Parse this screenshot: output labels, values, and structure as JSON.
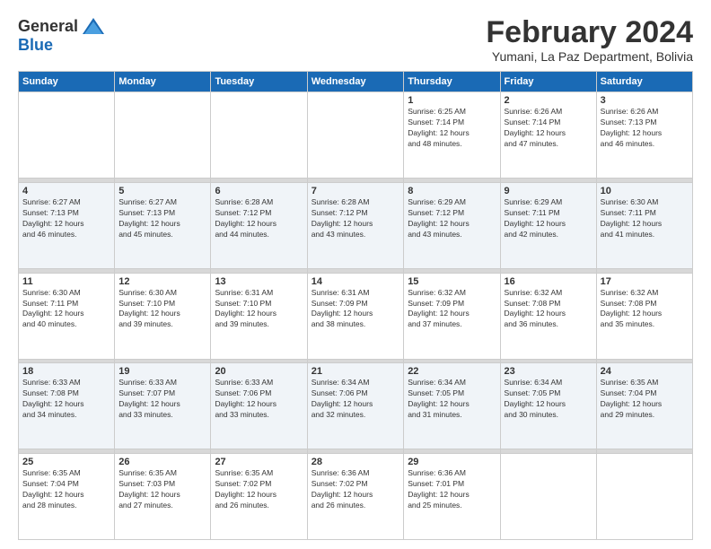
{
  "logo": {
    "general": "General",
    "blue": "Blue"
  },
  "title": "February 2024",
  "location": "Yumani, La Paz Department, Bolivia",
  "days_of_week": [
    "Sunday",
    "Monday",
    "Tuesday",
    "Wednesday",
    "Thursday",
    "Friday",
    "Saturday"
  ],
  "weeks": [
    [
      {
        "day": "",
        "info": ""
      },
      {
        "day": "",
        "info": ""
      },
      {
        "day": "",
        "info": ""
      },
      {
        "day": "",
        "info": ""
      },
      {
        "day": "1",
        "info": "Sunrise: 6:25 AM\nSunset: 7:14 PM\nDaylight: 12 hours\nand 48 minutes."
      },
      {
        "day": "2",
        "info": "Sunrise: 6:26 AM\nSunset: 7:14 PM\nDaylight: 12 hours\nand 47 minutes."
      },
      {
        "day": "3",
        "info": "Sunrise: 6:26 AM\nSunset: 7:13 PM\nDaylight: 12 hours\nand 46 minutes."
      }
    ],
    [
      {
        "day": "4",
        "info": "Sunrise: 6:27 AM\nSunset: 7:13 PM\nDaylight: 12 hours\nand 46 minutes."
      },
      {
        "day": "5",
        "info": "Sunrise: 6:27 AM\nSunset: 7:13 PM\nDaylight: 12 hours\nand 45 minutes."
      },
      {
        "day": "6",
        "info": "Sunrise: 6:28 AM\nSunset: 7:12 PM\nDaylight: 12 hours\nand 44 minutes."
      },
      {
        "day": "7",
        "info": "Sunrise: 6:28 AM\nSunset: 7:12 PM\nDaylight: 12 hours\nand 43 minutes."
      },
      {
        "day": "8",
        "info": "Sunrise: 6:29 AM\nSunset: 7:12 PM\nDaylight: 12 hours\nand 43 minutes."
      },
      {
        "day": "9",
        "info": "Sunrise: 6:29 AM\nSunset: 7:11 PM\nDaylight: 12 hours\nand 42 minutes."
      },
      {
        "day": "10",
        "info": "Sunrise: 6:30 AM\nSunset: 7:11 PM\nDaylight: 12 hours\nand 41 minutes."
      }
    ],
    [
      {
        "day": "11",
        "info": "Sunrise: 6:30 AM\nSunset: 7:11 PM\nDaylight: 12 hours\nand 40 minutes."
      },
      {
        "day": "12",
        "info": "Sunrise: 6:30 AM\nSunset: 7:10 PM\nDaylight: 12 hours\nand 39 minutes."
      },
      {
        "day": "13",
        "info": "Sunrise: 6:31 AM\nSunset: 7:10 PM\nDaylight: 12 hours\nand 39 minutes."
      },
      {
        "day": "14",
        "info": "Sunrise: 6:31 AM\nSunset: 7:09 PM\nDaylight: 12 hours\nand 38 minutes."
      },
      {
        "day": "15",
        "info": "Sunrise: 6:32 AM\nSunset: 7:09 PM\nDaylight: 12 hours\nand 37 minutes."
      },
      {
        "day": "16",
        "info": "Sunrise: 6:32 AM\nSunset: 7:08 PM\nDaylight: 12 hours\nand 36 minutes."
      },
      {
        "day": "17",
        "info": "Sunrise: 6:32 AM\nSunset: 7:08 PM\nDaylight: 12 hours\nand 35 minutes."
      }
    ],
    [
      {
        "day": "18",
        "info": "Sunrise: 6:33 AM\nSunset: 7:08 PM\nDaylight: 12 hours\nand 34 minutes."
      },
      {
        "day": "19",
        "info": "Sunrise: 6:33 AM\nSunset: 7:07 PM\nDaylight: 12 hours\nand 33 minutes."
      },
      {
        "day": "20",
        "info": "Sunrise: 6:33 AM\nSunset: 7:06 PM\nDaylight: 12 hours\nand 33 minutes."
      },
      {
        "day": "21",
        "info": "Sunrise: 6:34 AM\nSunset: 7:06 PM\nDaylight: 12 hours\nand 32 minutes."
      },
      {
        "day": "22",
        "info": "Sunrise: 6:34 AM\nSunset: 7:05 PM\nDaylight: 12 hours\nand 31 minutes."
      },
      {
        "day": "23",
        "info": "Sunrise: 6:34 AM\nSunset: 7:05 PM\nDaylight: 12 hours\nand 30 minutes."
      },
      {
        "day": "24",
        "info": "Sunrise: 6:35 AM\nSunset: 7:04 PM\nDaylight: 12 hours\nand 29 minutes."
      }
    ],
    [
      {
        "day": "25",
        "info": "Sunrise: 6:35 AM\nSunset: 7:04 PM\nDaylight: 12 hours\nand 28 minutes."
      },
      {
        "day": "26",
        "info": "Sunrise: 6:35 AM\nSunset: 7:03 PM\nDaylight: 12 hours\nand 27 minutes."
      },
      {
        "day": "27",
        "info": "Sunrise: 6:35 AM\nSunset: 7:02 PM\nDaylight: 12 hours\nand 26 minutes."
      },
      {
        "day": "28",
        "info": "Sunrise: 6:36 AM\nSunset: 7:02 PM\nDaylight: 12 hours\nand 26 minutes."
      },
      {
        "day": "29",
        "info": "Sunrise: 6:36 AM\nSunset: 7:01 PM\nDaylight: 12 hours\nand 25 minutes."
      },
      {
        "day": "",
        "info": ""
      },
      {
        "day": "",
        "info": ""
      }
    ]
  ]
}
